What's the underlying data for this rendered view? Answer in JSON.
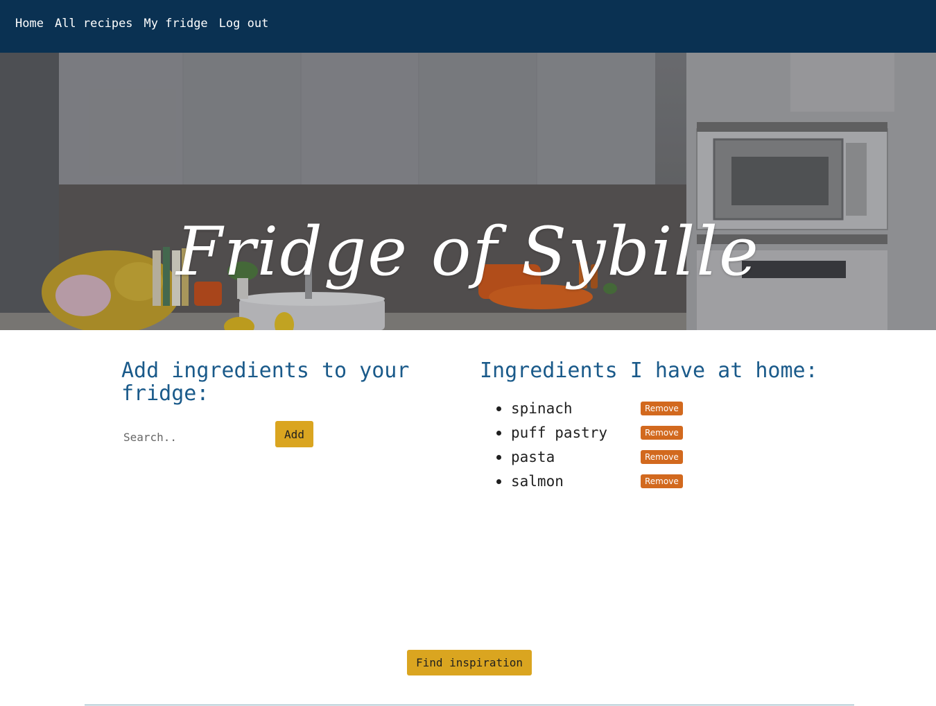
{
  "nav": {
    "items": [
      {
        "label": "Home"
      },
      {
        "label": "All recipes"
      },
      {
        "label": "My fridge"
      },
      {
        "label": "Log out"
      }
    ]
  },
  "hero": {
    "title": "Fridge of Sybille"
  },
  "add_section": {
    "title": "Add ingredients to your fridge:",
    "search_placeholder": "Search..",
    "add_label": "Add"
  },
  "home_section": {
    "title": "Ingredients I have at home:",
    "remove_label": "Remove",
    "ingredients": [
      {
        "name": "spinach"
      },
      {
        "name": "puff pastry"
      },
      {
        "name": "pasta"
      },
      {
        "name": "salmon"
      }
    ]
  },
  "actions": {
    "find_label": "Find inspiration"
  },
  "colors": {
    "nav_bg": "#0a3152",
    "heading": "#1a5a8a",
    "accent_gold": "#daa520",
    "remove_orange": "#d2691e"
  }
}
